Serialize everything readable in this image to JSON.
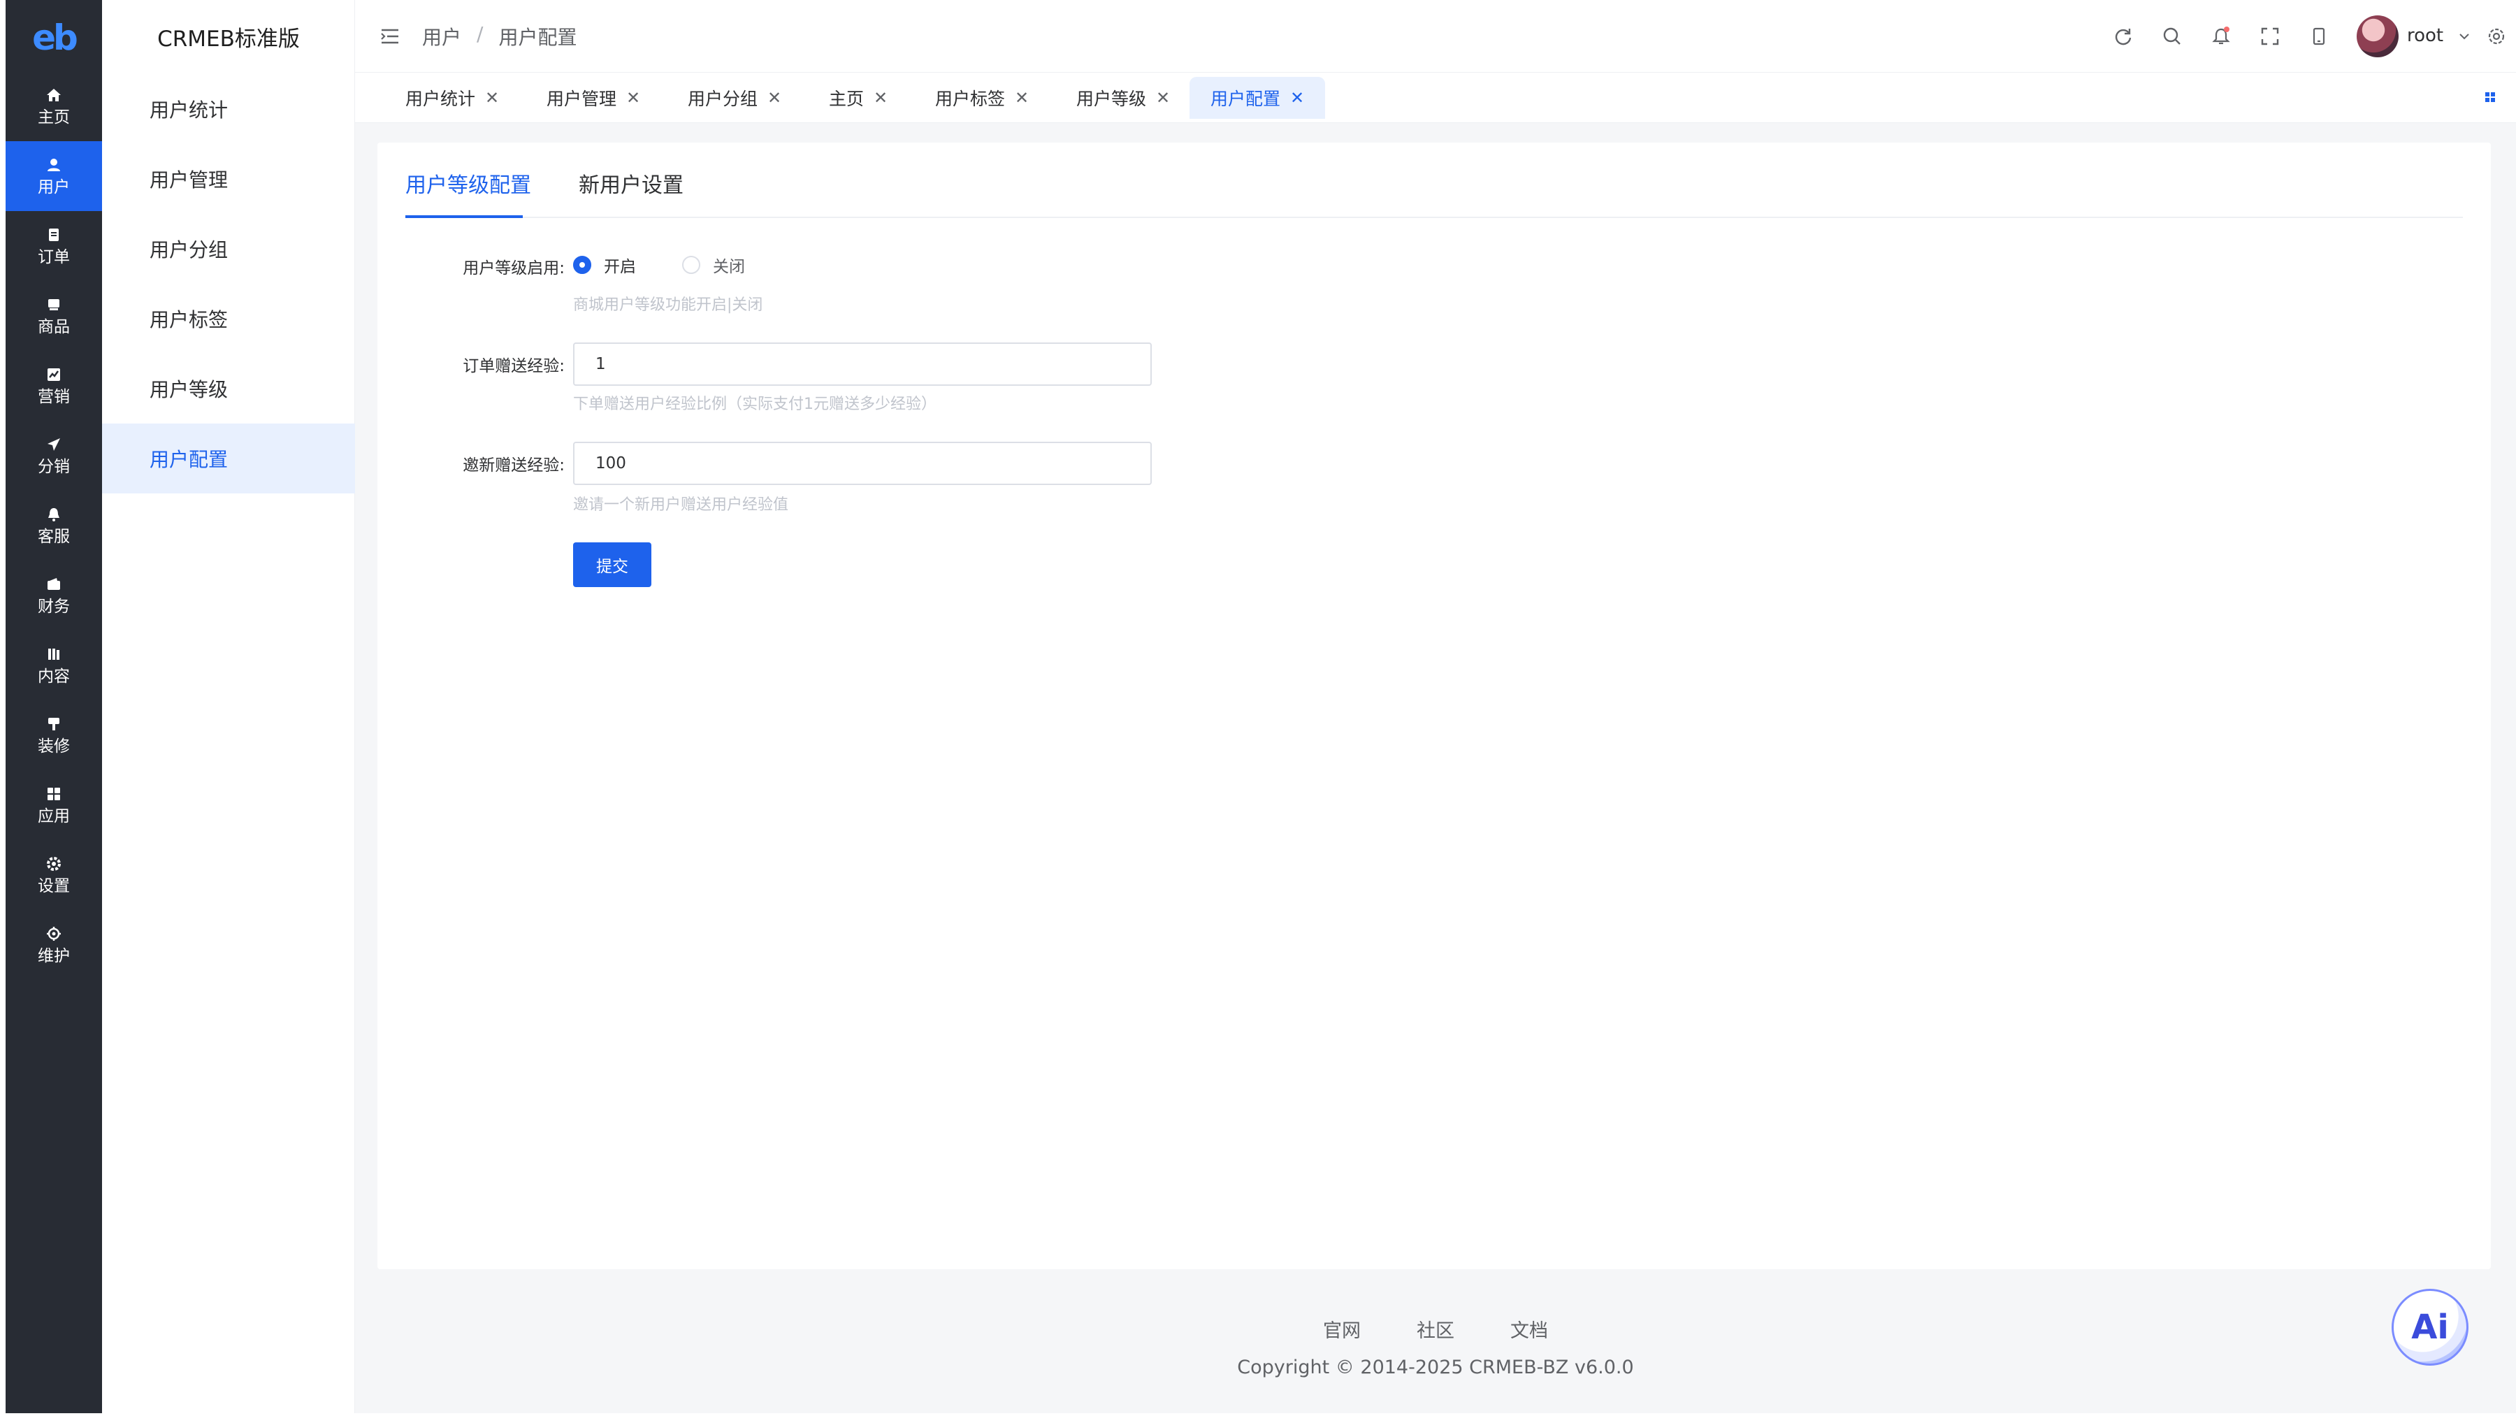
{
  "app": {
    "brand": "CRMEB标准版",
    "logo_text": "eb"
  },
  "rail": {
    "items": [
      {
        "label": "主页",
        "icon": "home-icon"
      },
      {
        "label": "用户",
        "icon": "user-icon"
      },
      {
        "label": "订单",
        "icon": "order-icon"
      },
      {
        "label": "商品",
        "icon": "product-icon"
      },
      {
        "label": "营销",
        "icon": "marketing-icon"
      },
      {
        "label": "分销",
        "icon": "send-icon"
      },
      {
        "label": "客服",
        "icon": "bell-icon"
      },
      {
        "label": "财务",
        "icon": "wallet-icon"
      },
      {
        "label": "内容",
        "icon": "book-icon"
      },
      {
        "label": "装修",
        "icon": "paint-icon"
      },
      {
        "label": "应用",
        "icon": "apps-icon"
      },
      {
        "label": "设置",
        "icon": "settings-icon"
      },
      {
        "label": "维护",
        "icon": "maintenance-icon"
      }
    ],
    "active": "用户"
  },
  "submenu": {
    "items": [
      "用户统计",
      "用户管理",
      "用户分组",
      "用户标签",
      "用户等级",
      "用户配置"
    ],
    "active": "用户配置"
  },
  "breadcrumb": {
    "parent": "用户",
    "separator": "/",
    "current": "用户配置"
  },
  "header": {
    "username": "root"
  },
  "tabs": [
    {
      "label": "用户统计"
    },
    {
      "label": "用户管理"
    },
    {
      "label": "用户分组"
    },
    {
      "label": "主页"
    },
    {
      "label": "用户标签"
    },
    {
      "label": "用户等级"
    },
    {
      "label": "用户配置",
      "active": true
    }
  ],
  "content_tabs": {
    "level_config": "用户等级配置",
    "new_user": "新用户设置"
  },
  "form": {
    "level_enable": {
      "label": "用户等级启用:",
      "option_on": "开启",
      "option_off": "关闭",
      "selected": "开启",
      "hint": "商城用户等级功能开启|关闭"
    },
    "order_exp": {
      "label": "订单赠送经验:",
      "value": "1",
      "hint": "下单赠送用户经验比例（实际支付1元赠送多少经验）"
    },
    "invite_exp": {
      "label": "邀新赠送经验:",
      "value": "100",
      "hint": "邀请一个新用户赠送用户经验值"
    },
    "submit_label": "提交"
  },
  "footer": {
    "links": [
      "官网",
      "社区",
      "文档"
    ],
    "copyright": "Copyright © 2014-2025 CRMEB-BZ v6.0.0"
  },
  "ai_button": {
    "label": "Ai"
  },
  "colors": {
    "accent": "#1e62ec",
    "rail_bg": "#282c34",
    "active_bg": "#e8f0fe"
  }
}
